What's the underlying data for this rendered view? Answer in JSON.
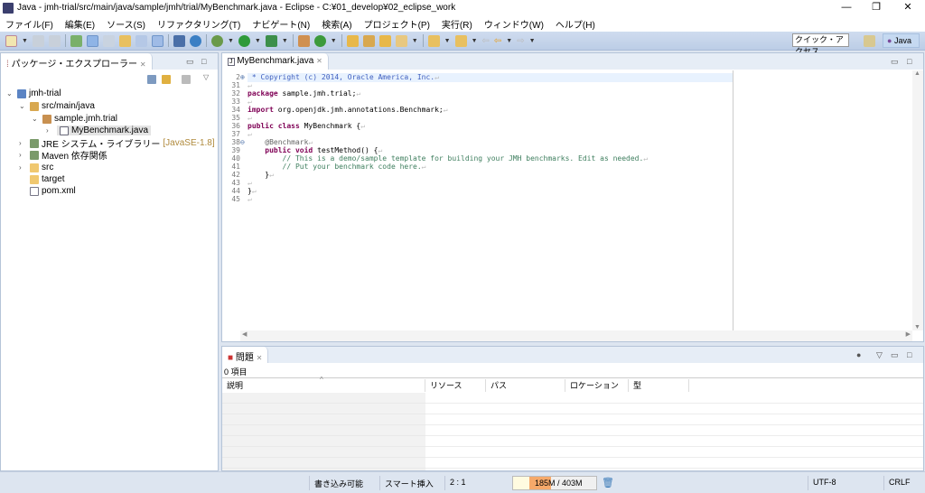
{
  "window": {
    "title": "Java - jmh-trial/src/main/java/sample/jmh/trial/MyBenchmark.java - Eclipse - C:¥01_develop¥02_eclipse_work",
    "minimize": "—",
    "maximize": "❐",
    "close": "✕"
  },
  "menu": [
    "ファイル(F)",
    "編集(E)",
    "ソース(S)",
    "リファクタリング(T)",
    "ナビゲート(N)",
    "検索(A)",
    "プロジェクト(P)",
    "実行(R)",
    "ウィンドウ(W)",
    "ヘルプ(H)"
  ],
  "toolbar": {
    "quick_access_placeholder": "クイック・アクセス",
    "perspective": "Java"
  },
  "explorer": {
    "title": "パッケージ・エクスプローラー",
    "items": [
      {
        "label": "jmh-trial"
      },
      {
        "label": "src/main/java"
      },
      {
        "label": "sample.jmh.trial"
      },
      {
        "label": "MyBenchmark.java"
      },
      {
        "label": "JRE システム・ライブラリー",
        "suffix": "[JavaSE-1.8]"
      },
      {
        "label": "Maven 依存関係"
      },
      {
        "label": "src"
      },
      {
        "label": "target"
      },
      {
        "label": "pom.xml"
      }
    ]
  },
  "editor": {
    "tab": "MyBenchmark.java",
    "lines": [
      {
        "n": "2",
        "t": " * Copyright (c) 2014, Oracle America, Inc.",
        "c": "jd"
      },
      {
        "n": "31",
        "t": ""
      },
      {
        "n": "32",
        "k": "package",
        "t": " sample.jmh.trial;"
      },
      {
        "n": "33",
        "t": ""
      },
      {
        "n": "34",
        "k": "import",
        "t": " org.openjdk.jmh.annotations.Benchmark;"
      },
      {
        "n": "35",
        "t": ""
      },
      {
        "n": "36",
        "k": "public class",
        "t": " MyBenchmark {"
      },
      {
        "n": "37",
        "t": ""
      },
      {
        "n": "38",
        "t": "    @Benchmark",
        "c": "an"
      },
      {
        "n": "39",
        "k": "    public void",
        "t": " testMethod() {"
      },
      {
        "n": "40",
        "t": "        // This is a demo/sample template for building your JMH benchmarks. Edit as needed.",
        "c": "cm"
      },
      {
        "n": "41",
        "t": "        // Put your benchmark code here.",
        "c": "cm"
      },
      {
        "n": "42",
        "t": "    }"
      },
      {
        "n": "43",
        "t": ""
      },
      {
        "n": "44",
        "t": "}"
      },
      {
        "n": "45",
        "t": ""
      }
    ]
  },
  "problems": {
    "title": "問題",
    "count": "0 項目",
    "columns": [
      "説明",
      "リソース",
      "パス",
      "ロケーション",
      "型"
    ]
  },
  "status": {
    "writable": "書き込み可能",
    "insert_mode": "スマート挿入",
    "position": "2 : 1",
    "memory": "185M / 403M",
    "memory_used_fraction": 0.46,
    "encoding": "UTF-8",
    "line_delimiter": "CRLF"
  }
}
